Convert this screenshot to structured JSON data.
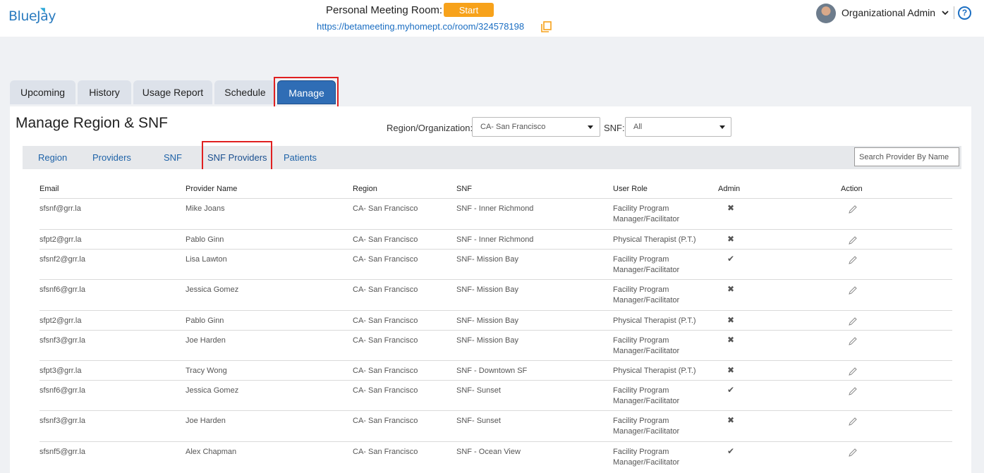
{
  "header": {
    "logo": "BlueJay",
    "personal_meeting_room_label": "Personal Meeting Room:",
    "start_label": "Start",
    "room_url": "https://betameeting.myhomept.co/room/324578198",
    "user_role": "Organizational Admin",
    "help_label": "?"
  },
  "main_tabs": [
    {
      "label": "Upcoming"
    },
    {
      "label": "History"
    },
    {
      "label": "Usage Report"
    },
    {
      "label": "Schedule"
    },
    {
      "label": "Manage",
      "active": true
    }
  ],
  "page": {
    "title": "Manage Region & SNF",
    "region_label": "Region/Organization:",
    "region_value": "CA- San Francisco",
    "snf_label": "SNF:",
    "snf_value": "All",
    "search_placeholder": "Search Provider By Name"
  },
  "sub_tabs": [
    {
      "label": "Region"
    },
    {
      "label": "Providers"
    },
    {
      "label": "SNF"
    },
    {
      "label": "SNF Providers",
      "active": true
    },
    {
      "label": "Patients"
    }
  ],
  "table": {
    "columns": [
      "Email",
      "Provider Name",
      "Region",
      "SNF",
      "User Role",
      "Admin",
      "Action"
    ],
    "rows": [
      {
        "email": "sfsnf@grr.la",
        "name": "Mike Joans",
        "region": "CA- San Francisco",
        "snf": "SNF - Inner Richmond",
        "role1": "Facility Program",
        "role2": "Manager/Facilitator",
        "admin": "✖"
      },
      {
        "email": "sfpt2@grr.la",
        "name": "Pablo Ginn",
        "region": "CA- San Francisco",
        "snf": "SNF - Inner Richmond",
        "role1": "Physical Therapist (P.T.)",
        "role2": "",
        "admin": "✖"
      },
      {
        "email": "sfsnf2@grr.la",
        "name": "Lisa Lawton",
        "region": "CA- San Francisco",
        "snf": "SNF- Mission Bay",
        "role1": "Facility Program",
        "role2": "Manager/Facilitator",
        "admin": "✔"
      },
      {
        "email": "sfsnf6@grr.la",
        "name": "Jessica Gomez",
        "region": "CA- San Francisco",
        "snf": "SNF- Mission Bay",
        "role1": "Facility Program",
        "role2": "Manager/Facilitator",
        "admin": "✖"
      },
      {
        "email": "sfpt2@grr.la",
        "name": "Pablo Ginn",
        "region": "CA- San Francisco",
        "snf": "SNF- Mission Bay",
        "role1": "Physical Therapist (P.T.)",
        "role2": "",
        "admin": "✖"
      },
      {
        "email": "sfsnf3@grr.la",
        "name": "Joe Harden",
        "region": "CA- San Francisco",
        "snf": "SNF- Mission Bay",
        "role1": "Facility Program",
        "role2": "Manager/Facilitator",
        "admin": "✖"
      },
      {
        "email": "sfpt3@grr.la",
        "name": "Tracy Wong",
        "region": "CA- San Francisco",
        "snf": "SNF - Downtown SF",
        "role1": "Physical Therapist (P.T.)",
        "role2": "",
        "admin": "✖"
      },
      {
        "email": "sfsnf6@grr.la",
        "name": "Jessica Gomez",
        "region": "CA- San Francisco",
        "snf": "SNF- Sunset",
        "role1": "Facility Program",
        "role2": "Manager/Facilitator",
        "admin": "✔"
      },
      {
        "email": "sfsnf3@grr.la",
        "name": "Joe Harden",
        "region": "CA- San Francisco",
        "snf": "SNF- Sunset",
        "role1": "Facility Program",
        "role2": "Manager/Facilitator",
        "admin": "✖"
      },
      {
        "email": "sfsnf5@grr.la",
        "name": "Alex Chapman",
        "region": "CA- San Francisco",
        "snf": "SNF - Ocean View",
        "role1": "Facility Program",
        "role2": "Manager/Facilitator",
        "admin": "✔"
      }
    ]
  },
  "colors": {
    "accent": "#2f6db5",
    "start": "#f7a21b",
    "highlight": "#e02020",
    "link": "#1f63a8"
  }
}
